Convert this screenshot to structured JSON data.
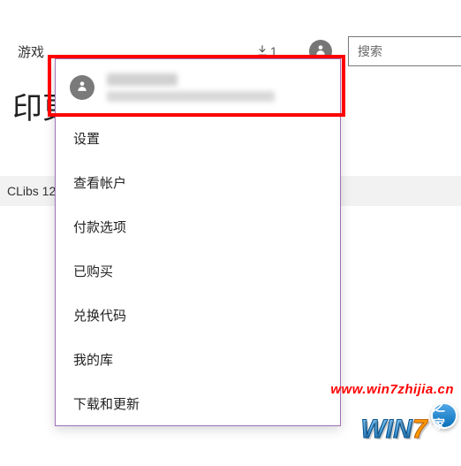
{
  "topbar": {
    "nav_label": "游戏",
    "download_count": "1",
    "search_placeholder": "搜索"
  },
  "page": {
    "title_fragment": "印更",
    "list_item_fragment": "CLibs 12"
  },
  "user_menu": {
    "items": [
      {
        "label": "设置"
      },
      {
        "label": "查看帐户"
      },
      {
        "label": "付款选项"
      },
      {
        "label": "已购买"
      },
      {
        "label": "兑换代码"
      },
      {
        "label": "我的库"
      },
      {
        "label": "下载和更新"
      }
    ]
  },
  "watermark": {
    "url": "www.win7zhijia.cn",
    "logo_main": "WIN",
    "logo_seven": "7",
    "logo_badge": "之家"
  },
  "icons": {
    "person": "person-icon",
    "download": "download-arrow-icon"
  }
}
